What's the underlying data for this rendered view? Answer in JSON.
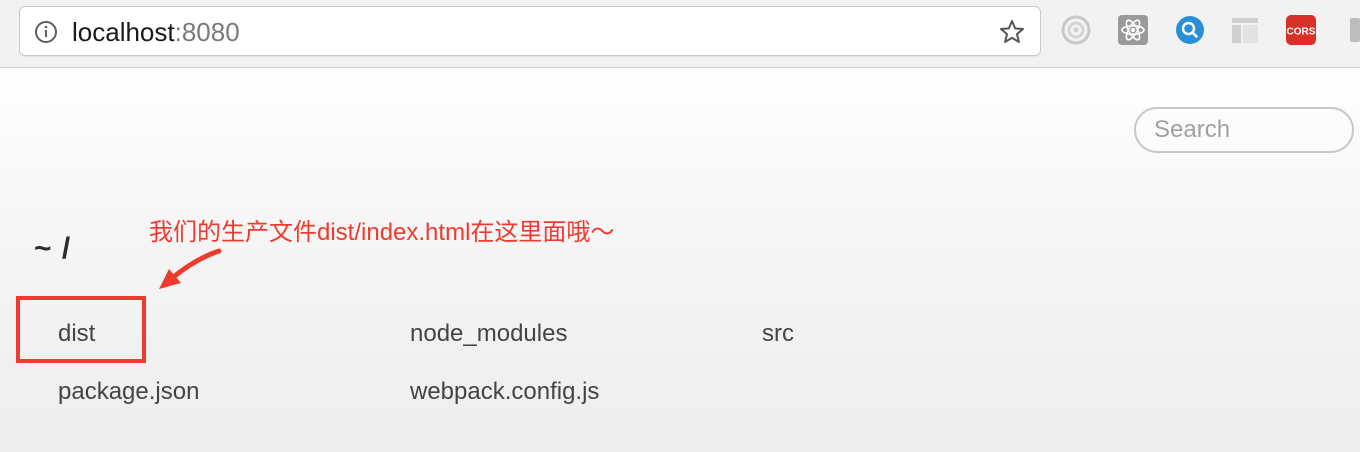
{
  "browser": {
    "url_host": "localhost",
    "url_port": ":8080",
    "extensions": [
      "timer-icon",
      "react-devtools-icon",
      "search-extension-icon",
      "layout-extension-icon",
      "cors-extension-icon"
    ],
    "cors_label": "CORS"
  },
  "page": {
    "search_placeholder": "Search",
    "breadcrumb": "~ /",
    "files": [
      "dist",
      "node_modules",
      "src",
      "package.json",
      "webpack.config.js"
    ]
  },
  "annotation": {
    "text": "我们的生产文件dist/index.html在这里面哦～",
    "color": "#ee3b2f"
  }
}
